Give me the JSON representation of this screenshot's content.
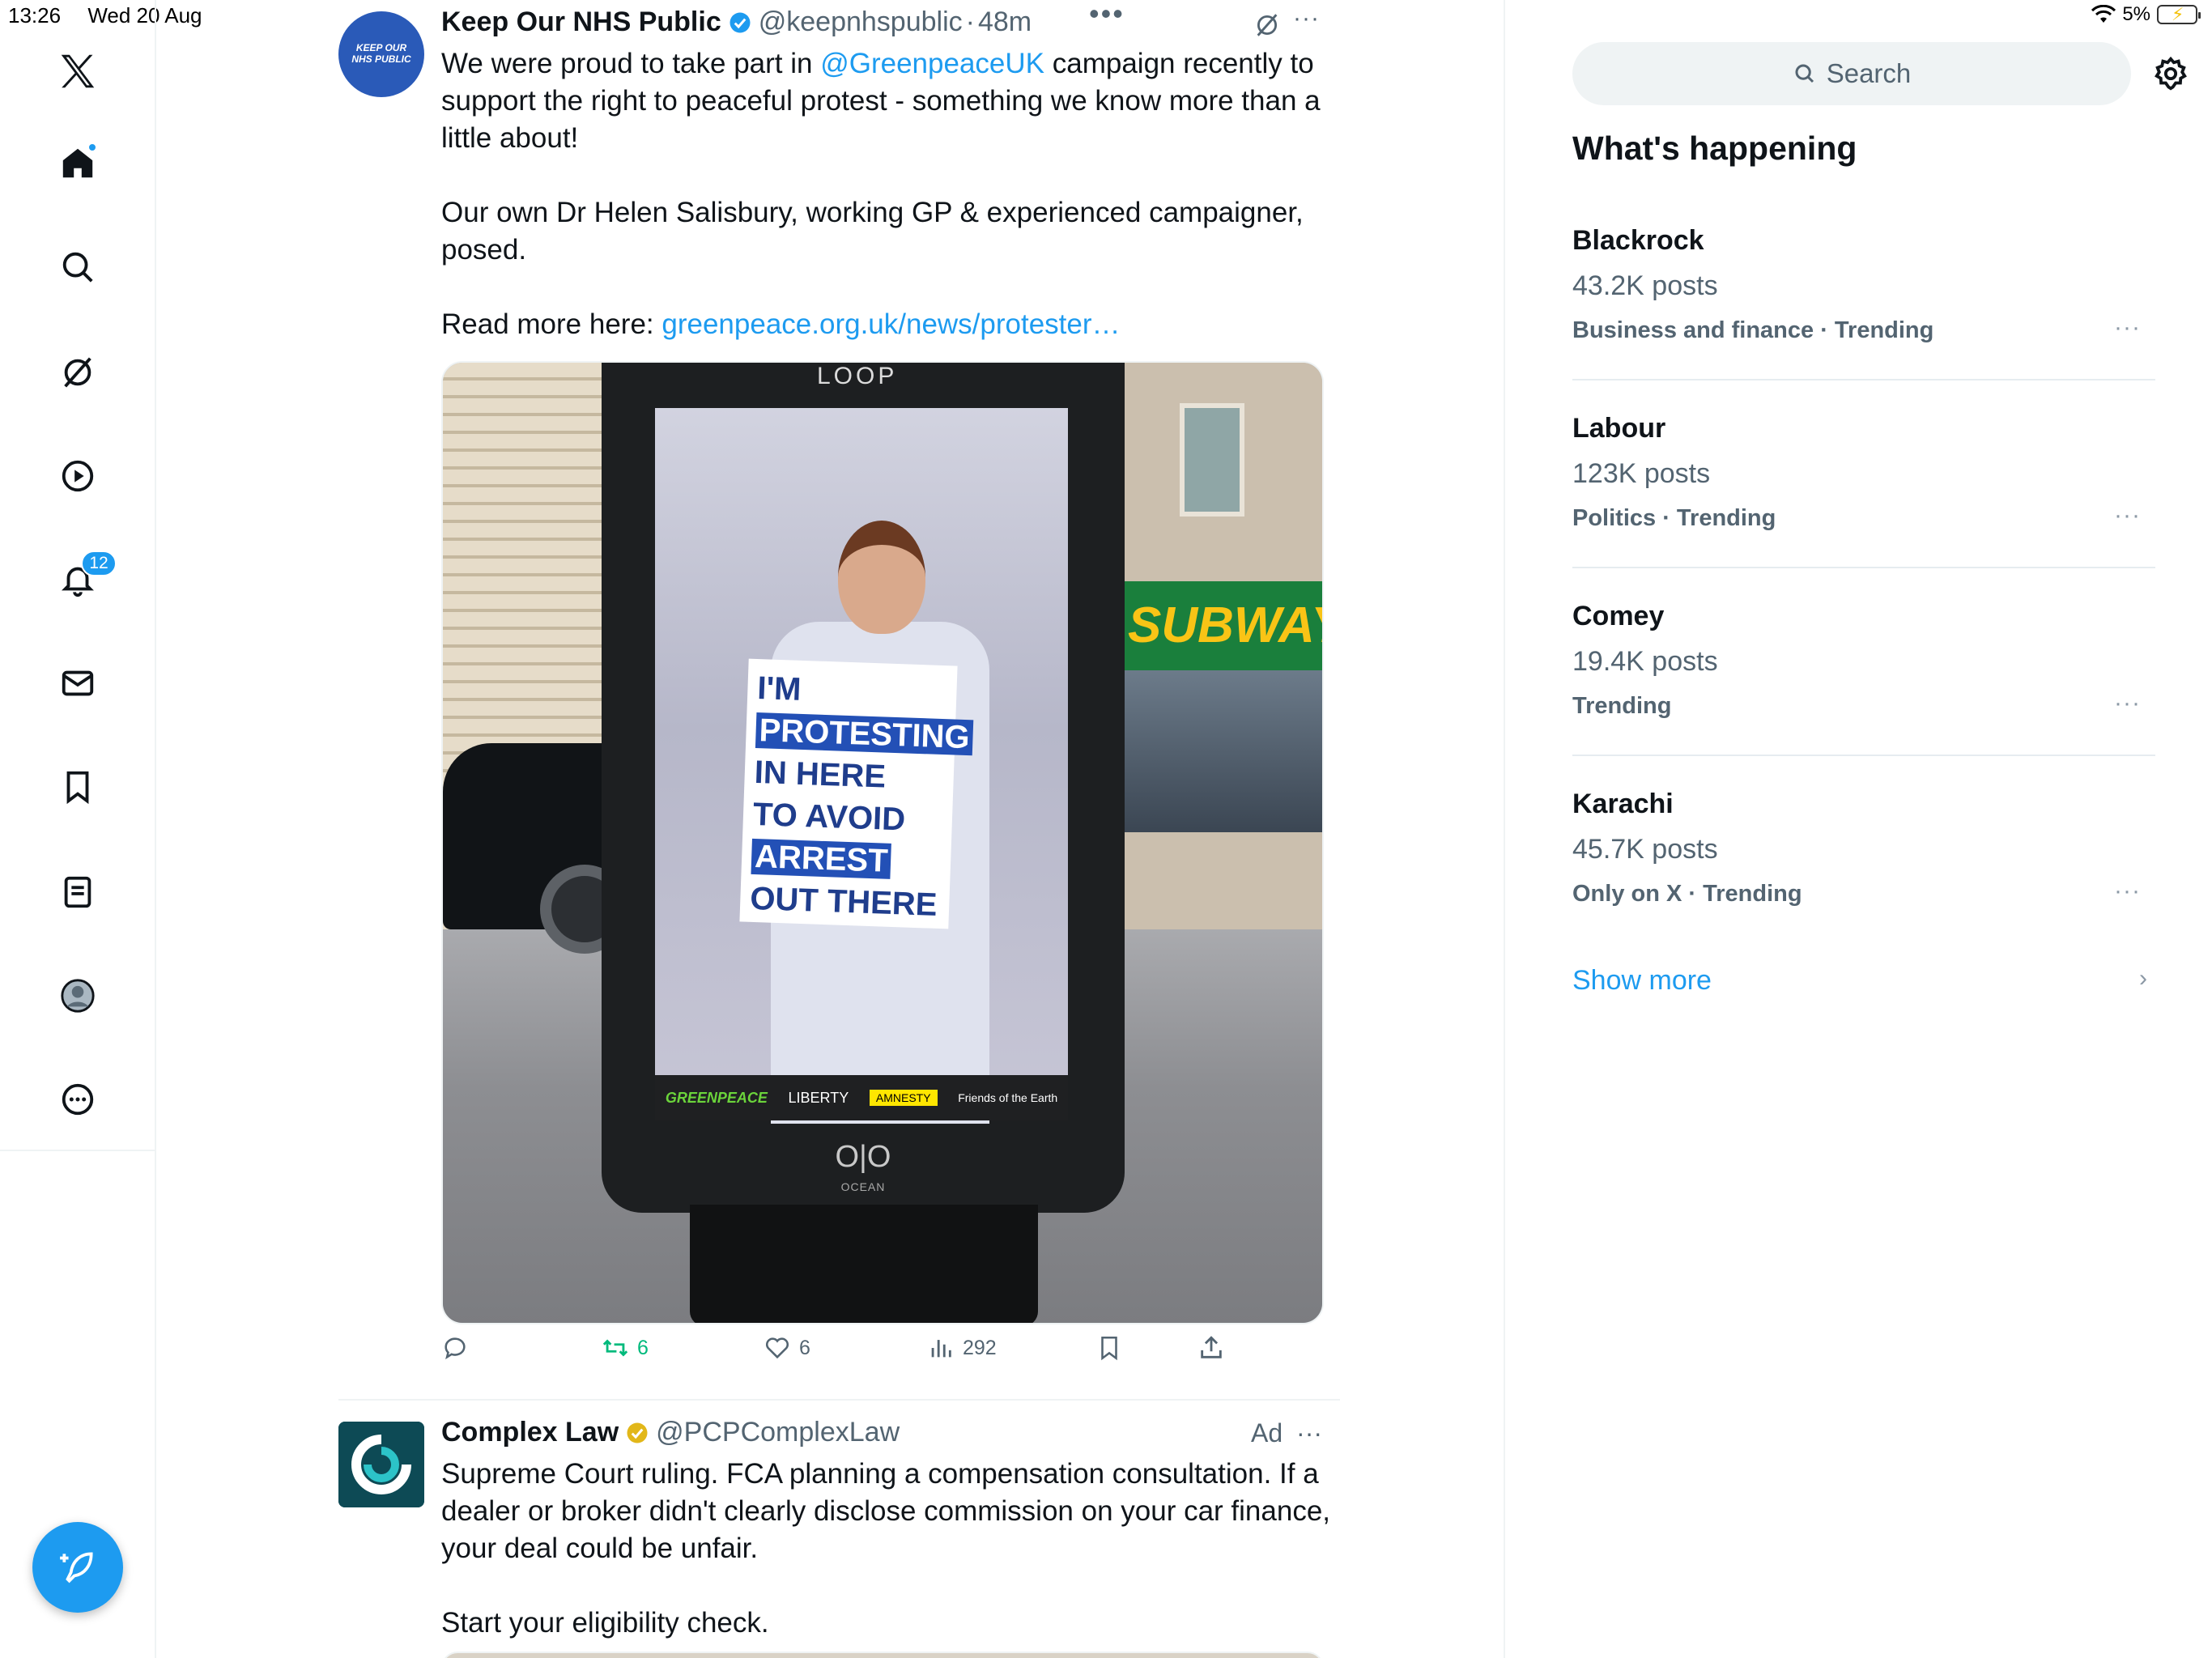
{
  "status_bar": {
    "time": "13:26",
    "date": "Wed 20 Aug",
    "battery": "5%"
  },
  "nav": {
    "items": [
      {
        "name": "X logo",
        "icon": "x-logo-icon"
      },
      {
        "name": "Home",
        "icon": "home-icon"
      },
      {
        "name": "Explore",
        "icon": "search-icon"
      },
      {
        "name": "Grok",
        "icon": "grok-icon"
      },
      {
        "name": "Video",
        "icon": "play-icon"
      },
      {
        "name": "Notifications",
        "icon": "bell-icon",
        "badge": "12"
      },
      {
        "name": "Messages",
        "icon": "mail-icon"
      },
      {
        "name": "Bookmarks",
        "icon": "bookmark-icon"
      },
      {
        "name": "Lists",
        "icon": "list-icon"
      },
      {
        "name": "Profile",
        "icon": "profile-icon"
      },
      {
        "name": "More",
        "icon": "more-icon"
      }
    ],
    "notifications_badge": "12",
    "compose_icon": "compose-icon"
  },
  "tweets": [
    {
      "avatar_text_line1": "KEEP OUR",
      "avatar_text_line2": "NHS PUBLIC",
      "display_name": "Keep Our NHS Public",
      "handle": "@keepnhspublic",
      "separator": "·",
      "time": "48m",
      "body": {
        "line1_before": "We were proud to take part in ",
        "mention": "@GreenpeaceUK",
        "line1_after": " campaign recently to support the right to peaceful protest - something we know more than a little about!",
        "para2": "Our own Dr Helen Salisbury, working GP & experienced campaigner, posed.",
        "para3_prefix": "Read more here: ",
        "link": "greenpeace.org.uk/news/protester…"
      },
      "media": {
        "billboard_brand": "LOOP",
        "sign_lines": [
          "I'M",
          "PROTESTING",
          "IN HERE",
          "TO AVOID",
          "ARREST",
          "OUT THERE"
        ],
        "store_sign": "SUBWAY",
        "sponsors": [
          "GREENPEACE",
          "LIBERTY",
          "AMNESTY",
          "Friends of the Earth"
        ],
        "ocean_logo": "O|O",
        "ocean_label": "OCEAN"
      },
      "actions": {
        "reply": "",
        "retweets": "6",
        "likes": "6",
        "views": "292"
      },
      "accent_color": "#1d9bf0",
      "retweet_color": "#00ba7c"
    },
    {
      "display_name": "Complex Law",
      "handle": "@PCPComplexLaw",
      "ad_label": "Ad",
      "body": {
        "para1": "Supreme Court ruling. FCA planning a compensation consultation. If a dealer or broker didn't clearly disclose commission on your car finance, your deal could be unfair.",
        "para2": "Start your eligibility check."
      }
    }
  ],
  "sidebar": {
    "search_placeholder": "Search",
    "trending_title": "What's happening",
    "trends": [
      {
        "name": "Blackrock",
        "count": "43.2K posts",
        "context": "Business and finance · Trending"
      },
      {
        "name": "Labour",
        "count": "123K posts",
        "context": "Politics · Trending"
      },
      {
        "name": "Comey",
        "count": "19.4K posts",
        "context": "Trending"
      },
      {
        "name": "Karachi",
        "count": "45.7K posts",
        "context": "Only on X · Trending"
      }
    ],
    "show_more": "Show more"
  }
}
